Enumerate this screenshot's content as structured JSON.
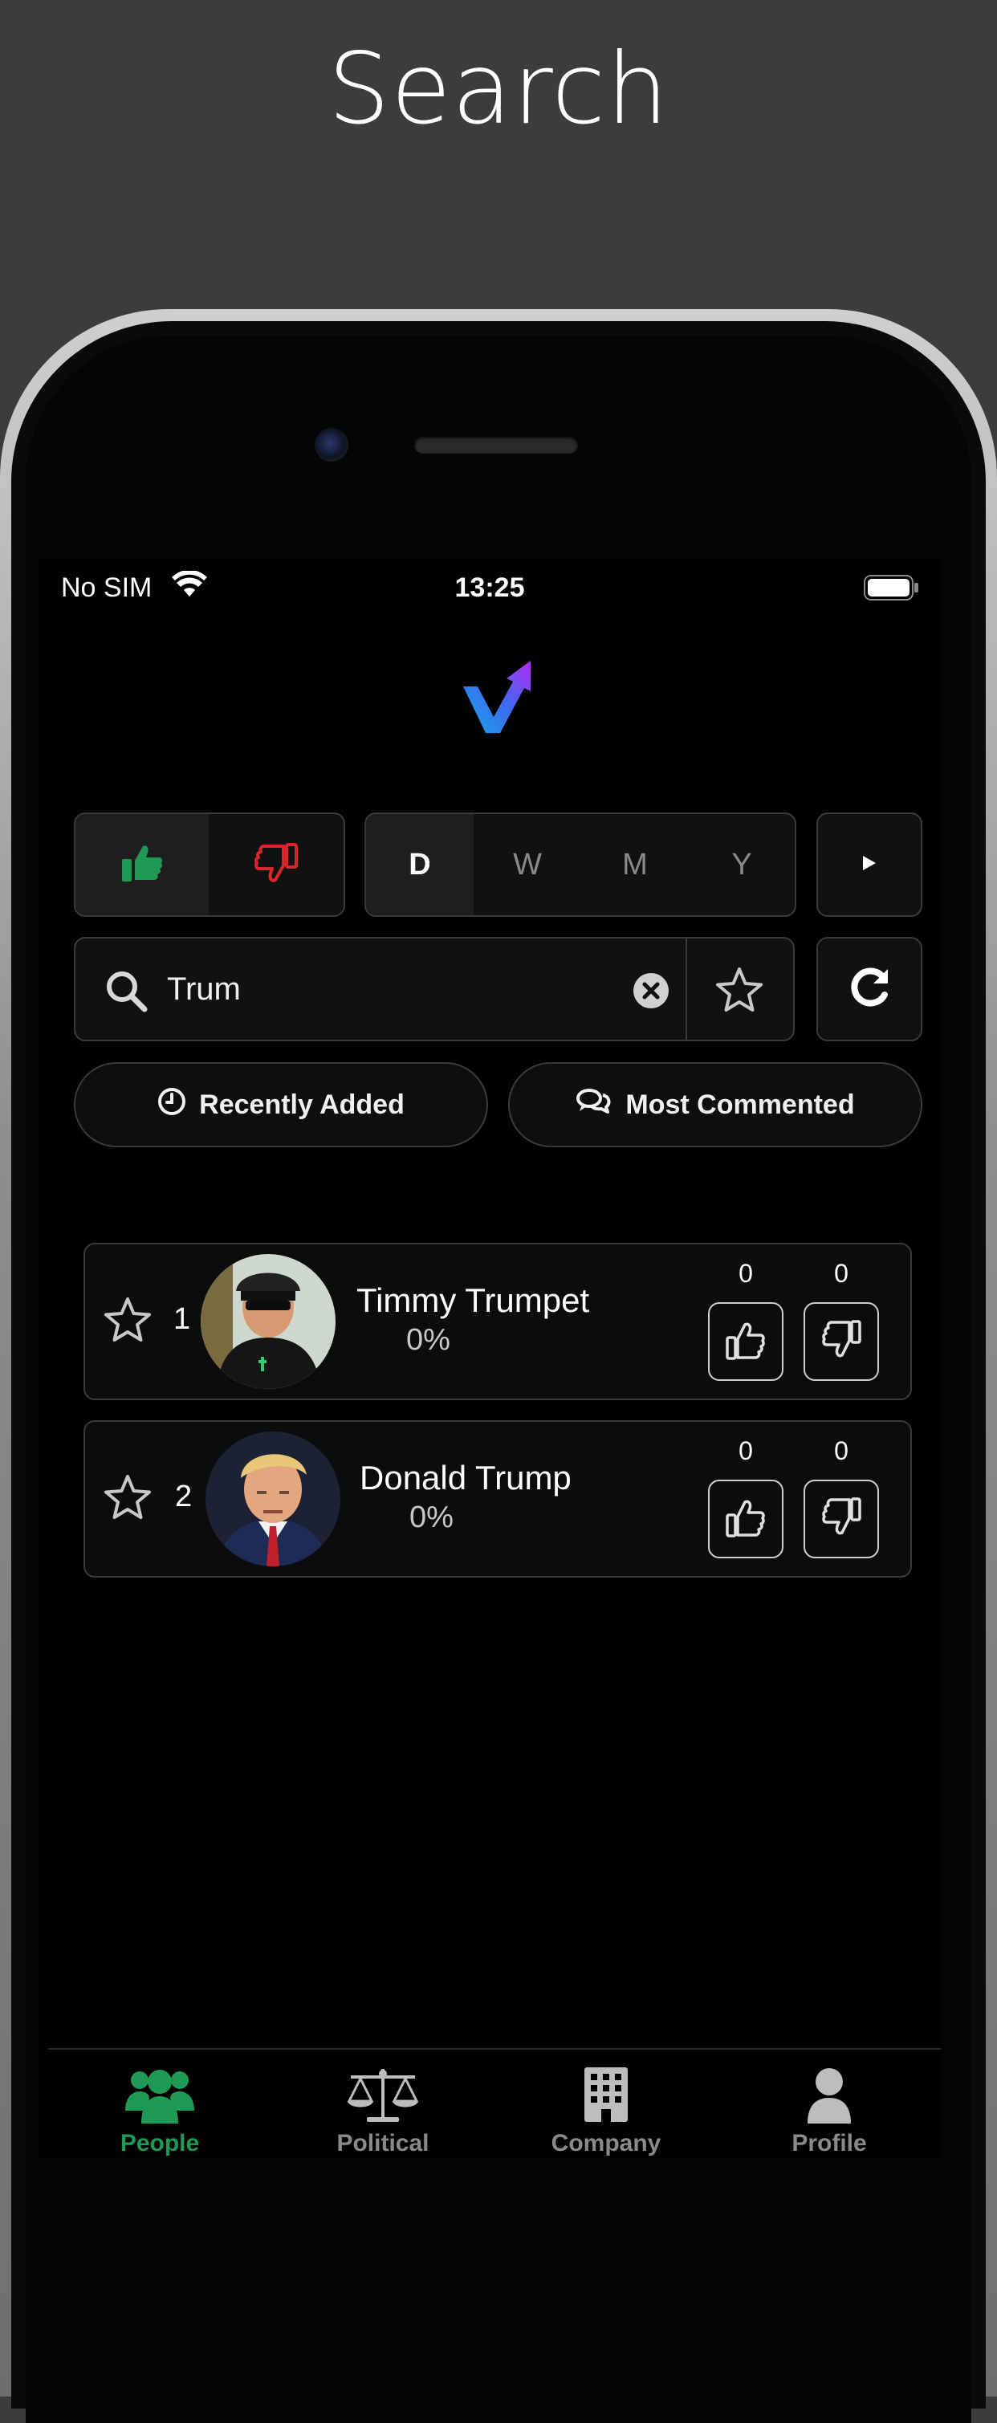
{
  "headline": "Search",
  "status_bar": {
    "carrier": "No SIM",
    "time": "13:25"
  },
  "vote_filter": {
    "up_label": "",
    "down_label": ""
  },
  "period_filter": {
    "options": [
      "D",
      "W",
      "M",
      "Y"
    ],
    "selected": "D"
  },
  "play_button": {
    "label": ""
  },
  "search": {
    "value": "Trum",
    "placeholder": ""
  },
  "sort_buttons": {
    "recently_added": "Recently Added",
    "most_commented": "Most Commented"
  },
  "results": [
    {
      "rank": "1",
      "name": "Timmy Trumpet",
      "percent": "0%",
      "up_count": "0",
      "down_count": "0"
    },
    {
      "rank": "2",
      "name": "Donald Trump",
      "percent": "0%",
      "up_count": "0",
      "down_count": "0"
    }
  ],
  "tabs": [
    {
      "label": "People",
      "icon": "people-icon",
      "active": true
    },
    {
      "label": "Political",
      "icon": "scales-icon",
      "active": false
    },
    {
      "label": "Company",
      "icon": "building-icon",
      "active": false
    },
    {
      "label": "Profile",
      "icon": "user-icon",
      "active": false
    }
  ],
  "colors": {
    "accent_green": "#1f9a55",
    "accent_red": "#d9262b",
    "logo_blue": "#1aa8e8",
    "logo_purple": "#9a2cf0"
  }
}
